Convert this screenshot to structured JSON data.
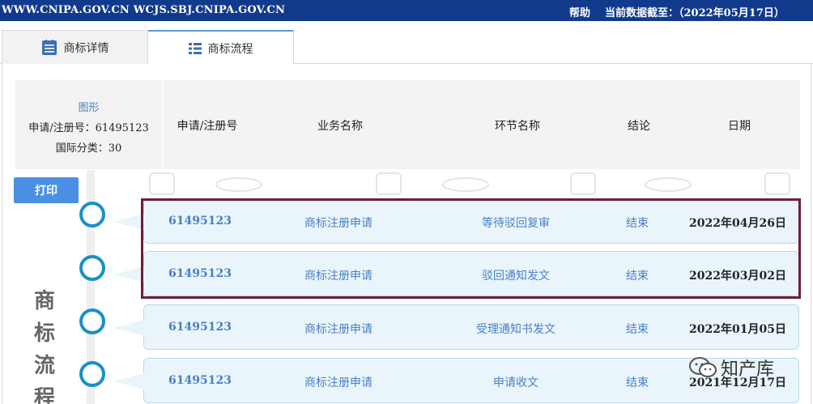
{
  "topbar": {
    "site": "WWW.CNIPA.GOV.CN WCJS.SBJ.CNIPA.GOV.CN",
    "help": "帮助",
    "as_of": "当前数据截至：（2022年05月17日）"
  },
  "tabs": [
    {
      "label": "商标详情",
      "active": false
    },
    {
      "label": "商标流程",
      "active": true
    }
  ],
  "info": {
    "type": "图形",
    "reg_line": "申请/注册号：61495123",
    "class_line": "国际分类：30"
  },
  "columns": [
    "申请/注册号",
    "业务名称",
    "环节名称",
    "结论",
    "日期"
  ],
  "print_label": "打印",
  "side_title": [
    "商",
    "标",
    "流",
    "程"
  ],
  "rows": [
    {
      "reg_no": "61495123",
      "business": "商标注册申请",
      "stage": "等待驳回复审",
      "result": "结束",
      "date": "2022年04月26日"
    },
    {
      "reg_no": "61495123",
      "business": "商标注册申请",
      "stage": "驳回通知发文",
      "result": "结束",
      "date": "2022年03月02日"
    },
    {
      "reg_no": "61495123",
      "business": "商标注册申请",
      "stage": "受理通知书发文",
      "result": "结束",
      "date": "2022年01月05日"
    },
    {
      "reg_no": "61495123",
      "business": "商标注册申请",
      "stage": "申请收文",
      "result": "结束",
      "date": "2021年12月17日"
    }
  ],
  "watermark_logo": "知产库",
  "colors": {
    "topbar": "#123a8c",
    "accent": "#1a8fc6",
    "highlight": "#6a1f3d"
  }
}
